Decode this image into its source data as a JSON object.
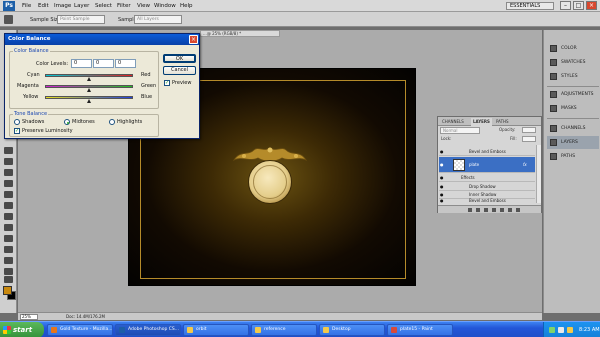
{
  "app": {
    "logo_text": "Ps",
    "menu": [
      "File",
      "Edit",
      "Image",
      "Layer",
      "Select",
      "Filter",
      "View",
      "Window",
      "Help"
    ],
    "workspace": "ESSENTIALS",
    "window_controls": [
      "–",
      "□",
      "×"
    ]
  },
  "options_bar": {
    "sample_size_label": "Sample Size:",
    "sample_size_value": "Point Sample",
    "sample_label": "Sample:",
    "sample_value": "All Layers"
  },
  "document": {
    "tab_title": "...@ 25% (RGB/8) *",
    "zoom": "25%",
    "doc_size": "Doc: 14.4M/176.2M"
  },
  "dock": {
    "items": [
      {
        "label": "COLOR",
        "icon": "color-icon"
      },
      {
        "label": "SWATCHES",
        "icon": "swatches-icon"
      },
      {
        "label": "STYLES",
        "icon": "styles-icon"
      },
      {
        "label": "ADJUSTMENTS",
        "icon": "adjustments-icon"
      },
      {
        "label": "MASKS",
        "icon": "masks-icon"
      },
      {
        "label": "CHANNELS",
        "icon": "channels-icon"
      },
      {
        "label": "LAYERS",
        "icon": "layers-icon"
      },
      {
        "label": "PATHS",
        "icon": "paths-icon"
      }
    ]
  },
  "color_balance": {
    "title": "Color Balance",
    "close": "×",
    "group_color_balance": "Color Balance",
    "color_levels_label": "Color Levels:",
    "levels": [
      "0",
      "0",
      "0"
    ],
    "sliders": [
      {
        "left": "Cyan",
        "right": "Red",
        "left_color": "#00c8d4",
        "right_color": "#e02020",
        "value": 0
      },
      {
        "left": "Magenta",
        "right": "Green",
        "left_color": "#d020d0",
        "right_color": "#20c020",
        "value": 0
      },
      {
        "left": "Yellow",
        "right": "Blue",
        "left_color": "#e8e020",
        "right_color": "#2040e0",
        "value": 0
      }
    ],
    "ok_label": "OK",
    "cancel_label": "Cancel",
    "preview_label": "Preview",
    "preview_checked": true,
    "group_tone_balance": "Tone Balance",
    "tones": [
      {
        "label": "Shadows",
        "selected": false
      },
      {
        "label": "Midtones",
        "selected": true
      },
      {
        "label": "Highlights",
        "selected": false
      }
    ],
    "preserve_label": "Preserve Luminosity",
    "preserve_checked": true
  },
  "layers_panel": {
    "tabs": [
      "CHANNELS",
      "LAYERS",
      "PATHS"
    ],
    "blend_mode": "Normal",
    "opacity_label": "Opacity:",
    "lock_label": "Lock:",
    "fill_label": "Fill:",
    "rows": [
      {
        "label": "Bevel and Emboss",
        "type": "effect"
      },
      {
        "label": "plate",
        "type": "layer"
      },
      {
        "label": "Effects",
        "type": "effects-header"
      },
      {
        "label": "Drop Shadow",
        "type": "effect"
      },
      {
        "label": "Inner Shadow",
        "type": "effect"
      },
      {
        "label": "Bevel and Emboss",
        "type": "effect"
      }
    ],
    "fx_label": "fx"
  },
  "taskbar": {
    "start_label": "start",
    "buttons": [
      {
        "label": "Gold Texture - Mozilla...",
        "icon_color": "#e8751a",
        "active": false
      },
      {
        "label": "Adobe Photoshop CS...",
        "icon_color": "#1d5fa8",
        "active": true
      },
      {
        "label": "orbit",
        "icon_color": "#f2c94c",
        "active": false
      },
      {
        "label": "reference",
        "icon_color": "#f2c94c",
        "active": false
      },
      {
        "label": "Desktop",
        "icon_color": "#f2c94c",
        "active": false
      },
      {
        "label": "plate15 - Paint",
        "icon_color": "#d94a3a",
        "active": false
      }
    ],
    "clock": "8:23 AM"
  }
}
